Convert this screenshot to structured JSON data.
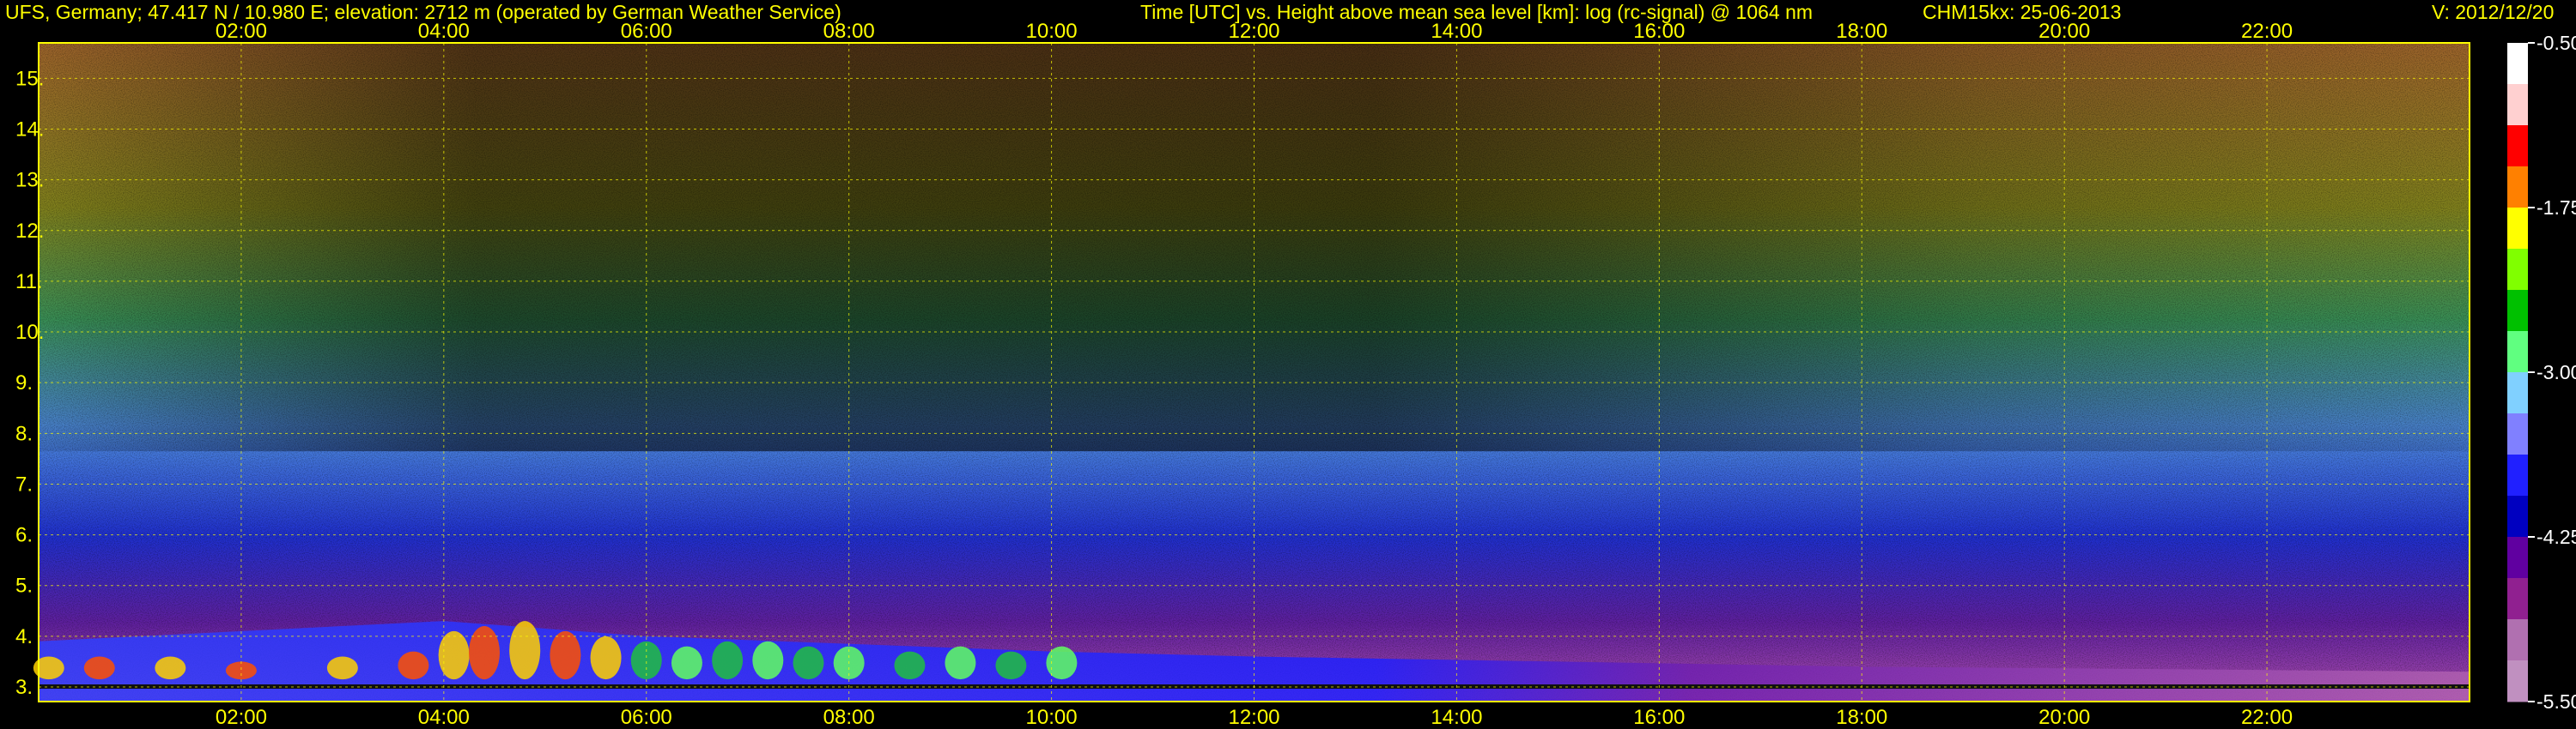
{
  "header": {
    "station": "UFS, Germany; 47.417 N / 10.980 E; elevation: 2712 m  (operated by German Weather Service)",
    "axis_desc": "Time [UTC] vs. Height above mean sea level [km]: log (rc-signal) @ 1064 nm",
    "instrument": "CHM15kx: 25-06-2013",
    "version": "V: 2012/12/20"
  },
  "colors": {
    "axis_text": "#ffff00",
    "grid": "#ffff00",
    "background": "#000000"
  },
  "chart_data": {
    "type": "heatmap",
    "title": "Time [UTC] vs. Height above mean sea level [km]: log (rc-signal) @ 1064 nm",
    "xlabel": "Time [UTC]",
    "ylabel": "Height above mean sea level [km]",
    "x_unit": "hours UTC",
    "xlim": [
      0,
      24
    ],
    "ylim": [
      2.712,
      15.7
    ],
    "x_ticks": [
      "02:00",
      "04:00",
      "06:00",
      "08:00",
      "10:00",
      "12:00",
      "14:00",
      "16:00",
      "18:00",
      "20:00",
      "22:00"
    ],
    "x_tick_values": [
      2,
      4,
      6,
      8,
      10,
      12,
      14,
      16,
      18,
      20,
      22
    ],
    "y_ticks": [
      "3.",
      "4.",
      "5.",
      "6.",
      "7.",
      "8.",
      "9.",
      "10.",
      "11.",
      "12.",
      "13.",
      "14.",
      "15."
    ],
    "y_tick_values": [
      3,
      4,
      5,
      6,
      7,
      8,
      9,
      10,
      11,
      12,
      13,
      14,
      15
    ],
    "grid": true,
    "colorbar": {
      "label": "log (rc-signal)",
      "ticks": [
        "-0.50",
        "-1.75",
        "-3.00",
        "-4.25",
        "-5.50"
      ],
      "tick_values": [
        -0.5,
        -1.75,
        -3.0,
        -4.25,
        -5.5
      ],
      "range": [
        -5.5,
        -0.5
      ],
      "colors": [
        "#ffffff",
        "#ffd0d0",
        "#ff0000",
        "#ff8000",
        "#ffff00",
        "#80ff00",
        "#00c000",
        "#60ff80",
        "#80d0ff",
        "#8080ff",
        "#2020ff",
        "#0000c0",
        "#6000a0",
        "#902090",
        "#b070b0",
        "#c090c0"
      ]
    },
    "features": [
      {
        "name": "aerosol layer top",
        "t": [
          0,
          4,
          6,
          10,
          12,
          15,
          18,
          24
        ],
        "h": [
          3.9,
          4.3,
          4.0,
          3.7,
          3.6,
          3.5,
          3.4,
          3.3
        ]
      },
      {
        "name": "strong backscatter cells",
        "t": [
          0.1,
          0.6,
          1.3,
          2.0,
          3.0,
          3.7,
          4.1,
          4.4,
          4.8,
          5.2,
          5.6,
          6.0,
          6.4,
          6.8,
          7.2,
          7.6,
          8.0,
          8.6,
          9.1,
          9.6,
          10.1
        ],
        "h": [
          3.6,
          3.6,
          3.6,
          3.5,
          3.6,
          3.7,
          4.1,
          4.2,
          4.3,
          4.1,
          4.0,
          3.9,
          3.8,
          3.9,
          3.9,
          3.8,
          3.8,
          3.7,
          3.8,
          3.7,
          3.8
        ]
      }
    ]
  }
}
